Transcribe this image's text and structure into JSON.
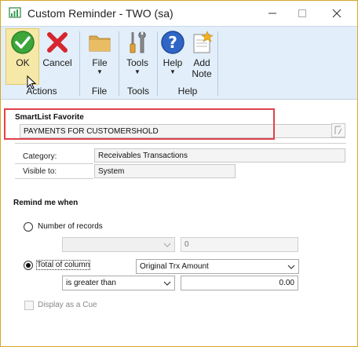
{
  "window": {
    "title": "Custom Reminder  -  TWO (sa)",
    "controls": [
      "minimize",
      "maximize",
      "close"
    ]
  },
  "ribbon": {
    "buttons": {
      "ok": {
        "label": "OK",
        "icon": "checkmark-icon"
      },
      "cancel": {
        "label": "Cancel",
        "icon": "red-x-icon"
      },
      "file": {
        "label": "File",
        "icon": "folder-icon"
      },
      "tools": {
        "label": "Tools",
        "icon": "tools-icon"
      },
      "help": {
        "label": "Help",
        "icon": "help-icon"
      },
      "add_note": {
        "label1": "Add",
        "label2": "Note",
        "icon": "note-icon"
      }
    },
    "groups": {
      "actions": "Actions",
      "file": "File",
      "tools": "Tools",
      "help": "Help"
    }
  },
  "smartlist": {
    "heading": "SmartList Favorite",
    "favorite_value": "PAYMENTS FOR CUSTOMERSHOLD",
    "category_label": "Category:",
    "category_value": "Receivables Transactions",
    "visible_label": "Visible to:",
    "visible_value": "System"
  },
  "remind": {
    "heading": "Remind me when",
    "number_of_records_label": "Number of records",
    "number_of_records_value": "0",
    "total_of_column_label": "Total of column",
    "column_value": "Original Trx Amount",
    "operator_value": "is greater than",
    "amount_value": "0.00",
    "cue_label": "Display as a Cue",
    "selected_option": "total_of_column"
  },
  "colors": {
    "highlight": "#e0424a",
    "ribbon_bg": "#e2eef9",
    "window_border": "#d4a72c"
  }
}
